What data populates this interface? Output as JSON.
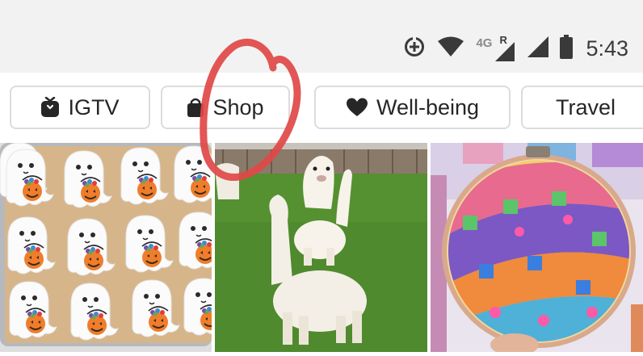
{
  "status_bar": {
    "network_label": "4G",
    "roaming_label": "R",
    "time": "5:43",
    "icons": [
      "data-saver-icon",
      "wifi-icon",
      "cell-signal-roaming-icon",
      "cell-signal-icon",
      "battery-icon"
    ]
  },
  "chips": [
    {
      "label": "IGTV",
      "icon": "igtv-icon"
    },
    {
      "label": "Shop",
      "icon": "shopping-bag-icon"
    },
    {
      "label": "Well-being",
      "icon": "heart-icon"
    },
    {
      "label": "Travel",
      "icon": ""
    }
  ],
  "grid": {
    "tiles": [
      {
        "name": "ghost-cookies-photo"
      },
      {
        "name": "alpacas-photo"
      },
      {
        "name": "punch-needle-hoop-photo"
      }
    ]
  },
  "annotation": {
    "color": "#e04848",
    "marks": "circle-around-shop-chip"
  }
}
